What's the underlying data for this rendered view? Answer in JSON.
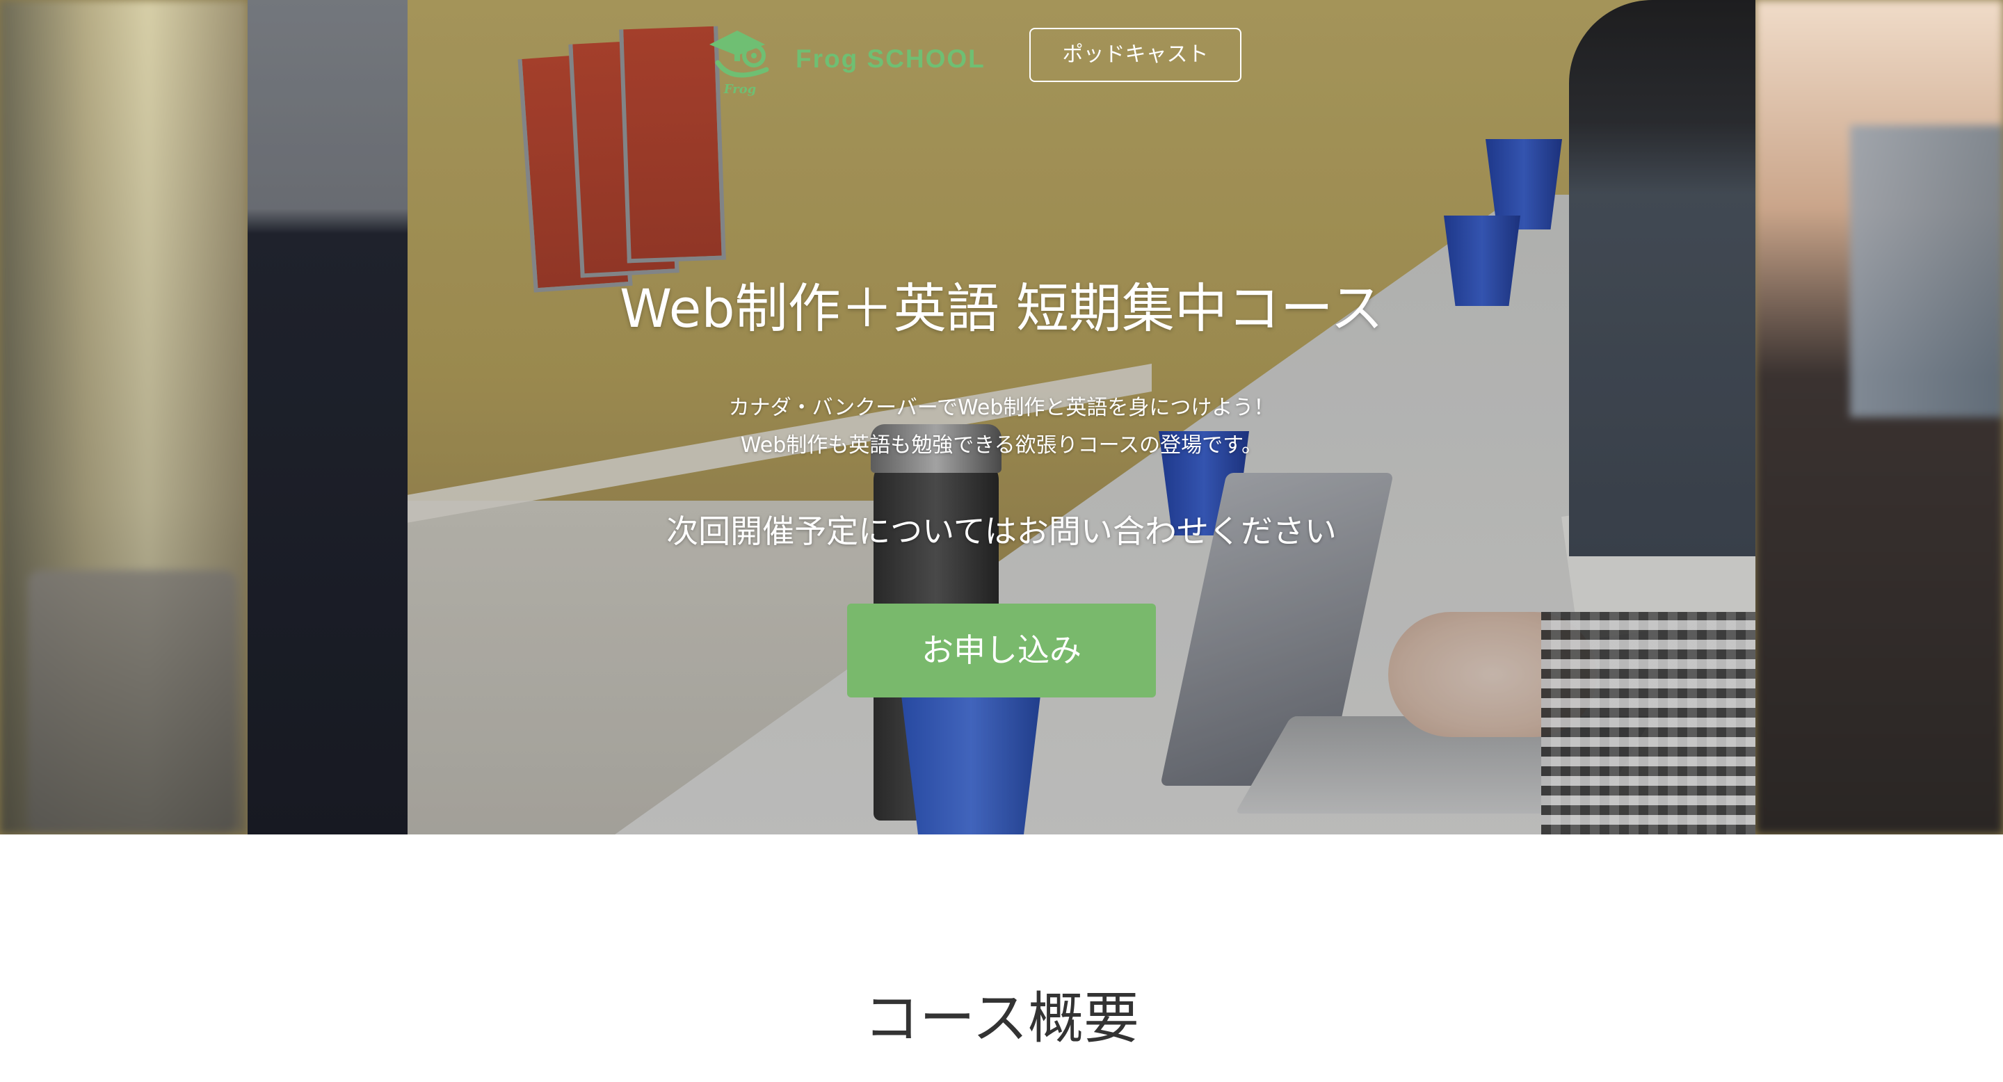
{
  "header": {
    "logo_text": "Frog SCHOOL",
    "logo_mark_text": "Frog",
    "podcast_label": "ポッドキャスト"
  },
  "hero": {
    "title": "Web制作＋英語 短期集中コース",
    "description_lines": [
      "カナダ・バンクーバーでWeb制作と英語を身につけよう！",
      "Web制作も英語も勉強できる欲張りコースの登場です。"
    ],
    "notice": "次回開催予定についてはお問い合わせください",
    "apply_label": "お申し込み"
  },
  "section": {
    "title": "コース概要"
  },
  "colors": {
    "brand_green": "#6fbf73",
    "button_green": "#79b96c",
    "text_dark": "#333333"
  },
  "icons": {
    "logo": "frog-with-graduation-cap-icon"
  }
}
